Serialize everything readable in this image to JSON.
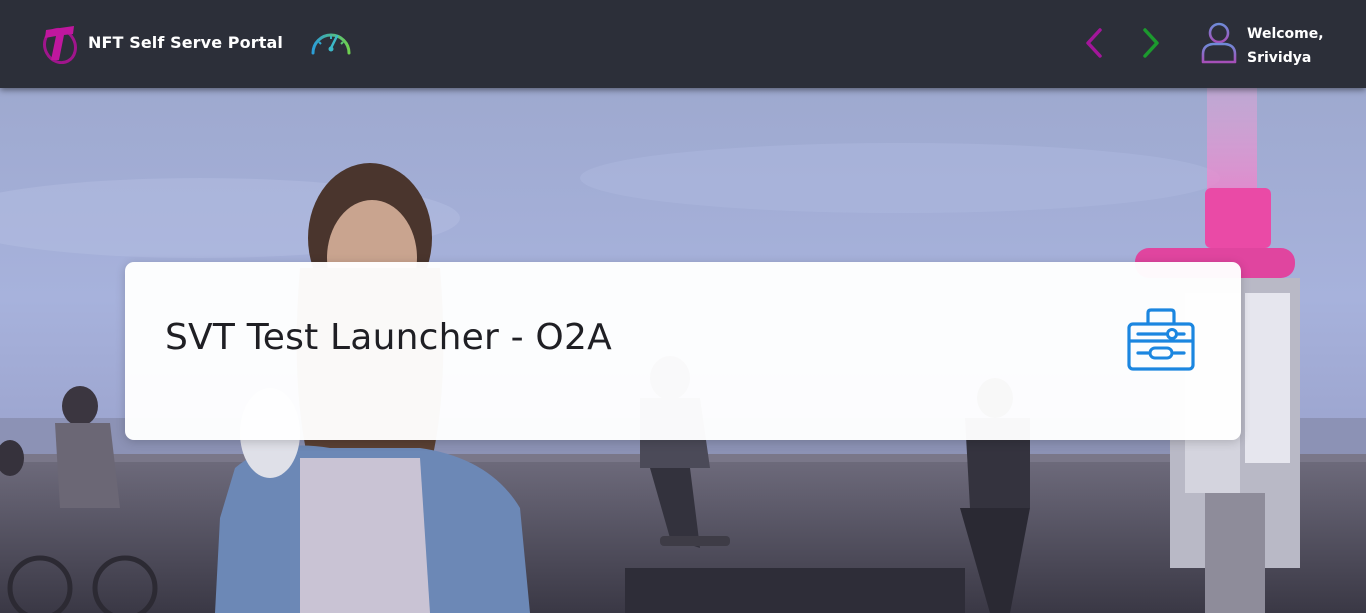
{
  "header": {
    "portal_title": "NFT Self Serve Portal",
    "logo_icon": "telstra-logo-icon",
    "dashboard_icon": "speedometer-icon",
    "nav_prev_icon": "chevron-left-icon",
    "nav_next_icon": "chevron-right-icon",
    "user_icon": "user-icon",
    "welcome_line1": "Welcome,",
    "welcome_line2": "Srividya"
  },
  "card": {
    "title": "SVT Test Launcher - O2A",
    "icon": "toolkit-icon"
  },
  "colors": {
    "header_bg": "#2c2f39",
    "brand_magenta": "#b0148e",
    "nav_prev": "#a3169a",
    "nav_next": "#1c9a2e",
    "icon_blue": "#1b86e0",
    "speedo_teal": "#2fb3c4"
  }
}
